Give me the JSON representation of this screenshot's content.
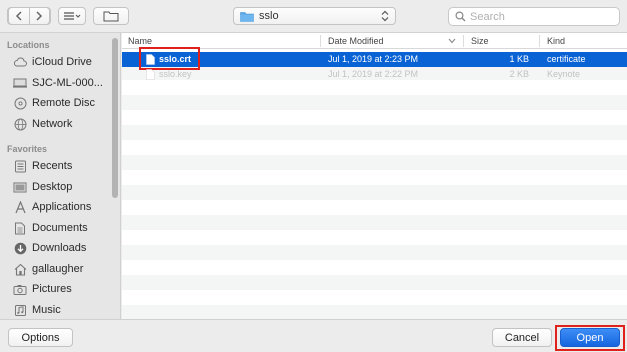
{
  "toolbar": {
    "path_label": "sslo",
    "search_placeholder": "Search"
  },
  "sidebar": {
    "locations_header": "Locations",
    "locations": [
      {
        "label": "iCloud Drive",
        "icon": "cloud-icon"
      },
      {
        "label": "SJC-ML-000...",
        "icon": "computer-icon"
      },
      {
        "label": "Remote Disc",
        "icon": "disc-icon"
      },
      {
        "label": "Network",
        "icon": "globe-icon"
      }
    ],
    "favorites_header": "Favorites",
    "favorites": [
      {
        "label": "Recents",
        "icon": "clock-icon"
      },
      {
        "label": "Desktop",
        "icon": "desktop-icon"
      },
      {
        "label": "Applications",
        "icon": "applications-icon"
      },
      {
        "label": "Documents",
        "icon": "document-icon"
      },
      {
        "label": "Downloads",
        "icon": "download-icon"
      },
      {
        "label": "gallaugher",
        "icon": "home-icon"
      },
      {
        "label": "Pictures",
        "icon": "camera-icon"
      },
      {
        "label": "Music",
        "icon": "music-icon"
      }
    ]
  },
  "columns": {
    "name": "Name",
    "date": "Date Modified",
    "size": "Size",
    "kind": "Kind"
  },
  "files": [
    {
      "name": "sslo.crt",
      "date": "Jul 1, 2019 at 2:23 PM",
      "size": "1 KB",
      "kind": "certificate",
      "selected": true
    },
    {
      "name": "sslo.key",
      "date": "Jul 1, 2019 at 2:22 PM",
      "size": "2 KB",
      "kind": "Keynote",
      "selected": false
    }
  ],
  "buttons": {
    "options": "Options",
    "cancel": "Cancel",
    "open": "Open"
  },
  "colors": {
    "selection": "#0a63d4",
    "highlight_box": "#e0201b"
  }
}
